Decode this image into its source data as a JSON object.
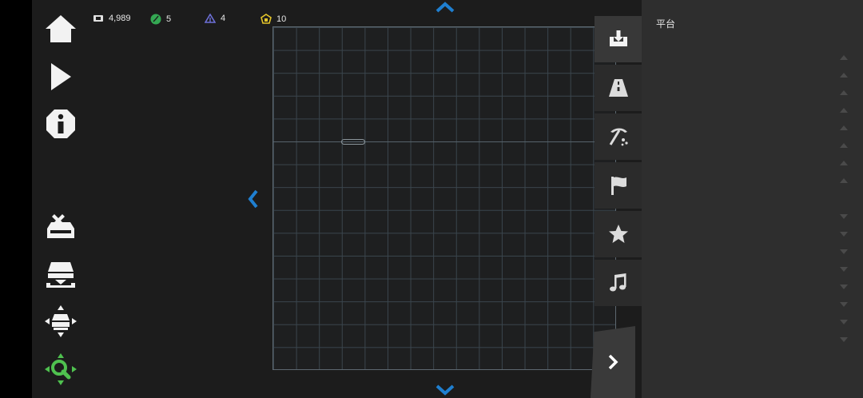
{
  "stats": [
    {
      "icon": "money-icon",
      "value": "4,989",
      "color": "#e0e0e0"
    },
    {
      "icon": "seed-icon",
      "value": "5",
      "color": "#34a853"
    },
    {
      "icon": "tent-icon",
      "value": "4",
      "color": "#6c6fd6"
    },
    {
      "icon": "house-token-icon",
      "value": "10",
      "color": "#e3c42a"
    }
  ],
  "panel": {
    "title": "平台"
  },
  "colors": {
    "accent_blue": "#1f7fd0",
    "grid_line": "#3a454d",
    "zoom_green": "#4fc14f"
  },
  "left_toolbar": [
    "home-icon",
    "play-icon",
    "info-icon",
    "clear-stage-icon",
    "save-stage-icon",
    "move-icon",
    "zoom-icon"
  ],
  "right_tabs": [
    "import-icon",
    "road-icon",
    "pickaxe-icon",
    "flag-icon",
    "star-icon",
    "music-icon"
  ]
}
